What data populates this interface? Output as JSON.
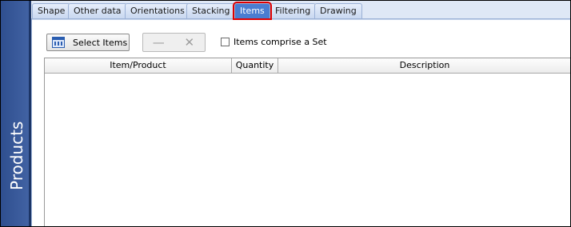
{
  "sidebar": {
    "label": "Products"
  },
  "tabs": [
    {
      "label": "Shape"
    },
    {
      "label": "Other data"
    },
    {
      "label": "Orientations"
    },
    {
      "label": "Stacking"
    },
    {
      "label": "Items",
      "active": true
    },
    {
      "label": "Filtering"
    },
    {
      "label": "Drawing"
    }
  ],
  "toolbar": {
    "select_items_label": "Select Items",
    "select_items_icon": "table-icon",
    "remove_icon": "minus-icon",
    "delete_icon": "x-icon",
    "set_checkbox_label": "Items comprise a Set",
    "set_checkbox_checked": false
  },
  "grid": {
    "columns": [
      "Item/Product",
      "Quantity",
      "Description"
    ],
    "rows": []
  },
  "colors": {
    "sidebar": "#3b5998",
    "active_tab": "#4a7dd1",
    "highlight": "#e00000"
  }
}
